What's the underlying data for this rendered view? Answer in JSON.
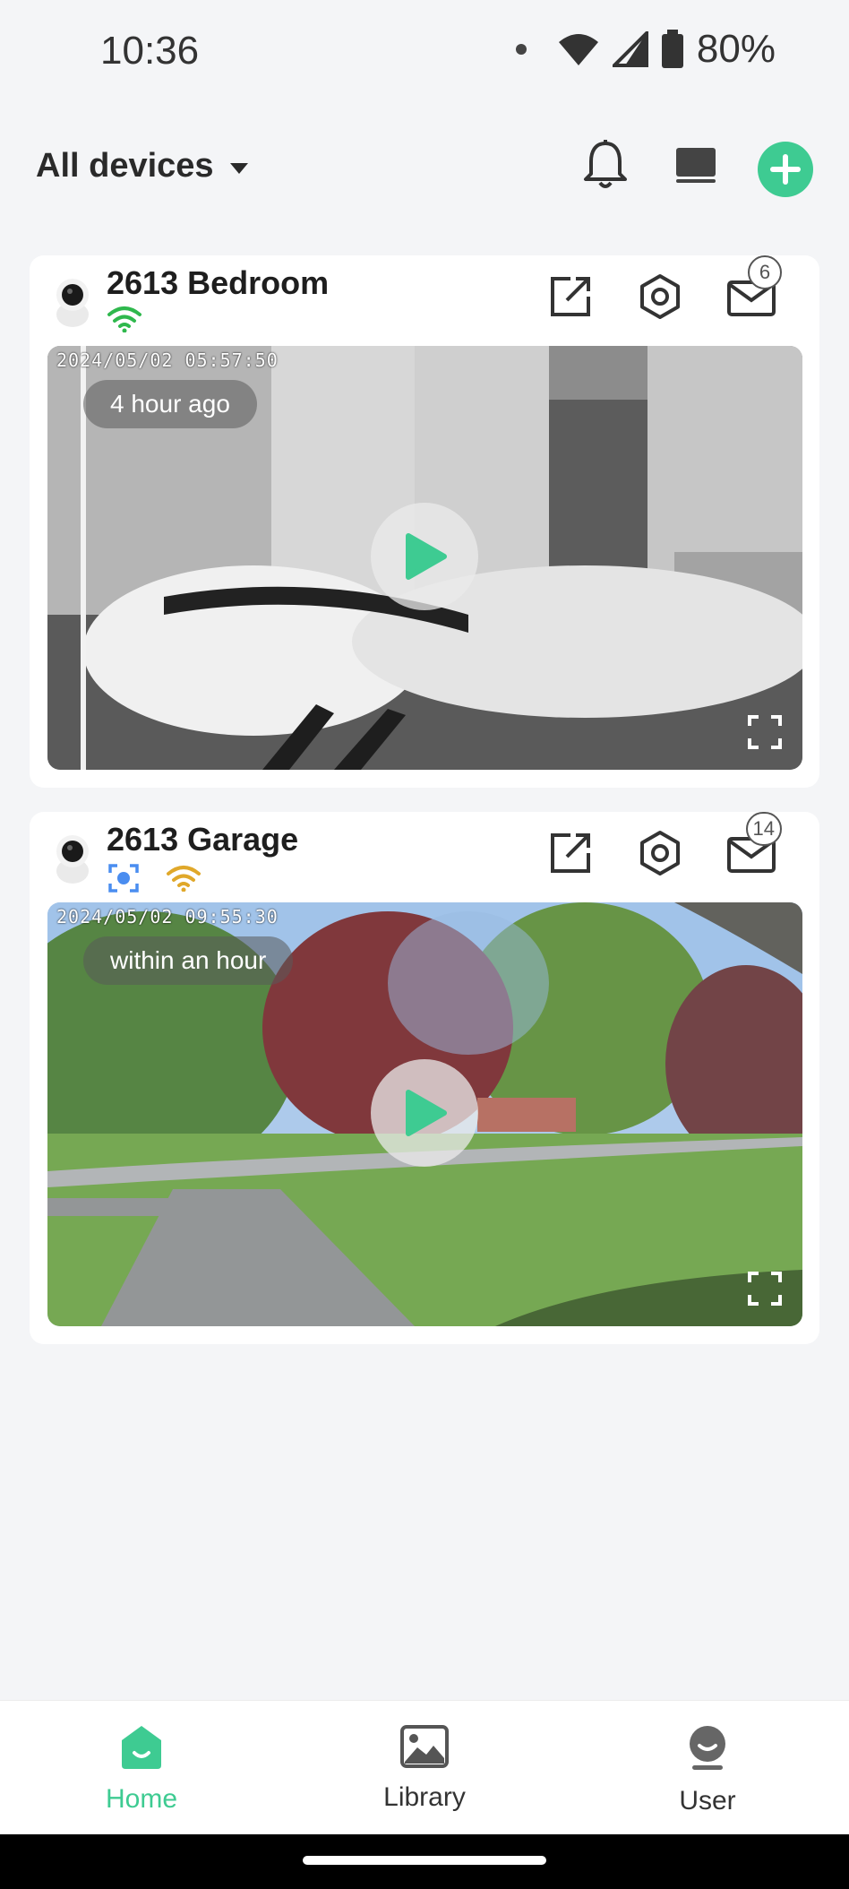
{
  "status_bar": {
    "time": "10:36",
    "battery": "80%"
  },
  "header": {
    "filter_label": "All devices"
  },
  "devices": [
    {
      "name": "2613 Bedroom",
      "timestamp": "2024/05/02 05:57:50",
      "ago": "4 hour ago",
      "messages": "6",
      "wifi_color": "#2fb84d",
      "night_mode": true
    },
    {
      "name": "2613 Garage",
      "timestamp": "2024/05/02 09:55:30",
      "ago": "within an hour",
      "messages": "14",
      "wifi_color": "#e0a82a",
      "night_mode": false
    }
  ],
  "bottom_nav": {
    "items": [
      {
        "label": "Home",
        "icon": "home-icon",
        "active": true
      },
      {
        "label": "Library",
        "icon": "image-icon",
        "active": false
      },
      {
        "label": "User",
        "icon": "user-icon",
        "active": false
      }
    ]
  },
  "colors": {
    "accent": "#3ecb92",
    "background": "#f4f5f7"
  }
}
